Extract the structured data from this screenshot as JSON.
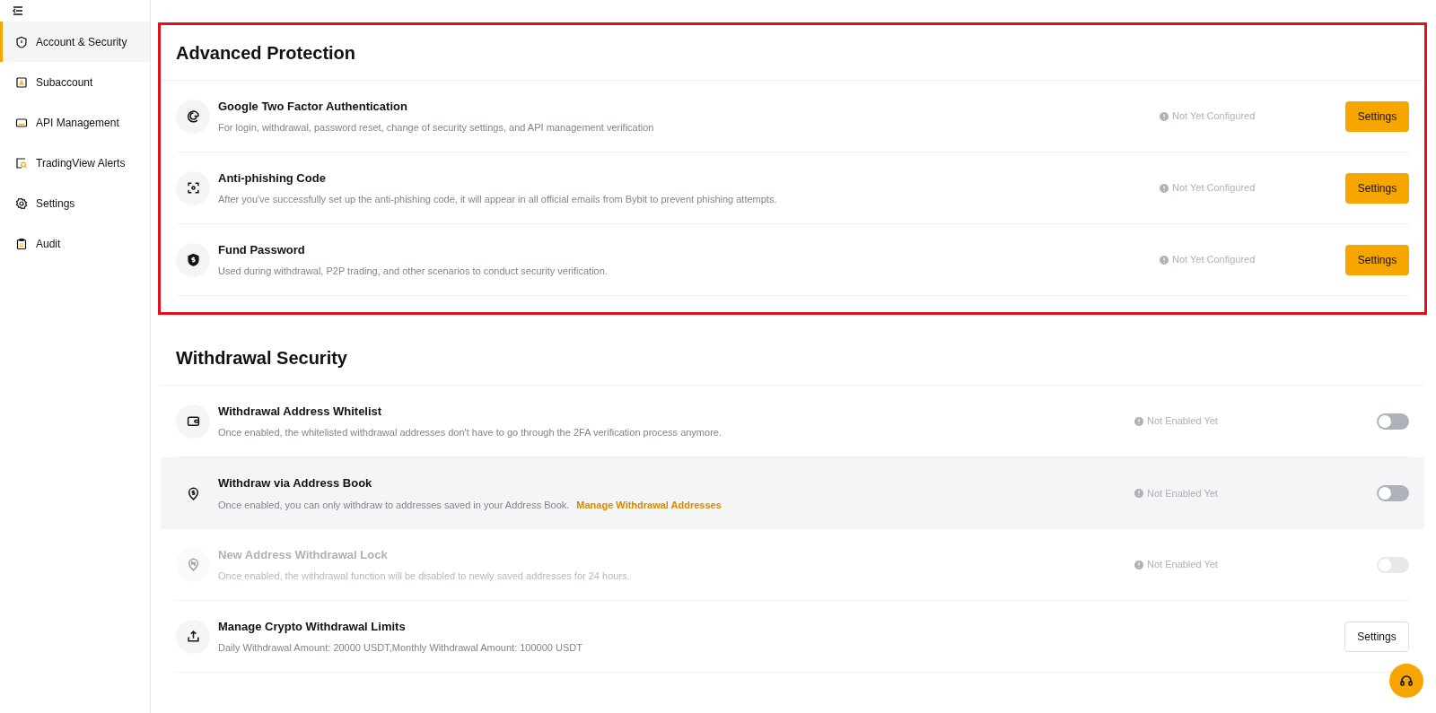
{
  "sidebar": {
    "items": [
      {
        "label": "Account & Security",
        "selected": true
      },
      {
        "label": "Subaccount",
        "selected": false
      },
      {
        "label": "API Management",
        "selected": false
      },
      {
        "label": "TradingView Alerts",
        "selected": false
      },
      {
        "label": "Settings",
        "selected": false
      },
      {
        "label": "Audit",
        "selected": false
      }
    ]
  },
  "sections": [
    {
      "title": "Advanced Protection",
      "outlined": true,
      "rows": [
        {
          "kind": "primary-button",
          "title": "Google Two Factor Authentication",
          "description": "For login, withdrawal, password reset, change of security settings, and API management verification",
          "status": "Not Yet Configured",
          "button": "Settings",
          "highlighted": false,
          "disabled": false
        },
        {
          "kind": "primary-button",
          "title": "Anti-phishing Code",
          "description": "After you've successfully set up the anti-phishing code, it will appear in all official emails from Bybit to prevent phishing attempts.",
          "status": "Not Yet Configured",
          "button": "Settings",
          "highlighted": false,
          "disabled": false
        },
        {
          "kind": "primary-button",
          "title": "Fund Password",
          "description": "Used during withdrawal, P2P trading, and other scenarios to conduct security verification.",
          "status": "Not Yet Configured",
          "button": "Settings",
          "highlighted": false,
          "disabled": false
        }
      ]
    },
    {
      "title": "Withdrawal Security",
      "outlined": false,
      "rows": [
        {
          "kind": "toggle",
          "title": "Withdrawal Address Whitelist",
          "description": "Once enabled, the whitelisted withdrawal addresses don't have to go through the 2FA verification process anymore.",
          "status": "Not Enabled Yet",
          "on": false,
          "highlighted": false,
          "disabled": false
        },
        {
          "kind": "toggle",
          "title": "Withdraw via Address Book",
          "description": "Once enabled, you can only withdraw to addresses saved in your Address Book.",
          "link": "Manage Withdrawal Addresses",
          "status": "Not Enabled Yet",
          "on": false,
          "highlighted": true,
          "disabled": false
        },
        {
          "kind": "toggle",
          "title": "New Address Withdrawal Lock",
          "description": "Once enabled, the withdrawal function will be disabled to newly saved addresses for 24 hours.",
          "status": "Not Enabled Yet",
          "on": false,
          "highlighted": false,
          "disabled": true
        },
        {
          "kind": "outline-button",
          "title": "Manage Crypto Withdrawal Limits",
          "description": "Daily Withdrawal Amount: 20000 USDT,Monthly Withdrawal Amount: 100000 USDT",
          "button": "Settings",
          "highlighted": false,
          "disabled": false
        }
      ]
    }
  ]
}
